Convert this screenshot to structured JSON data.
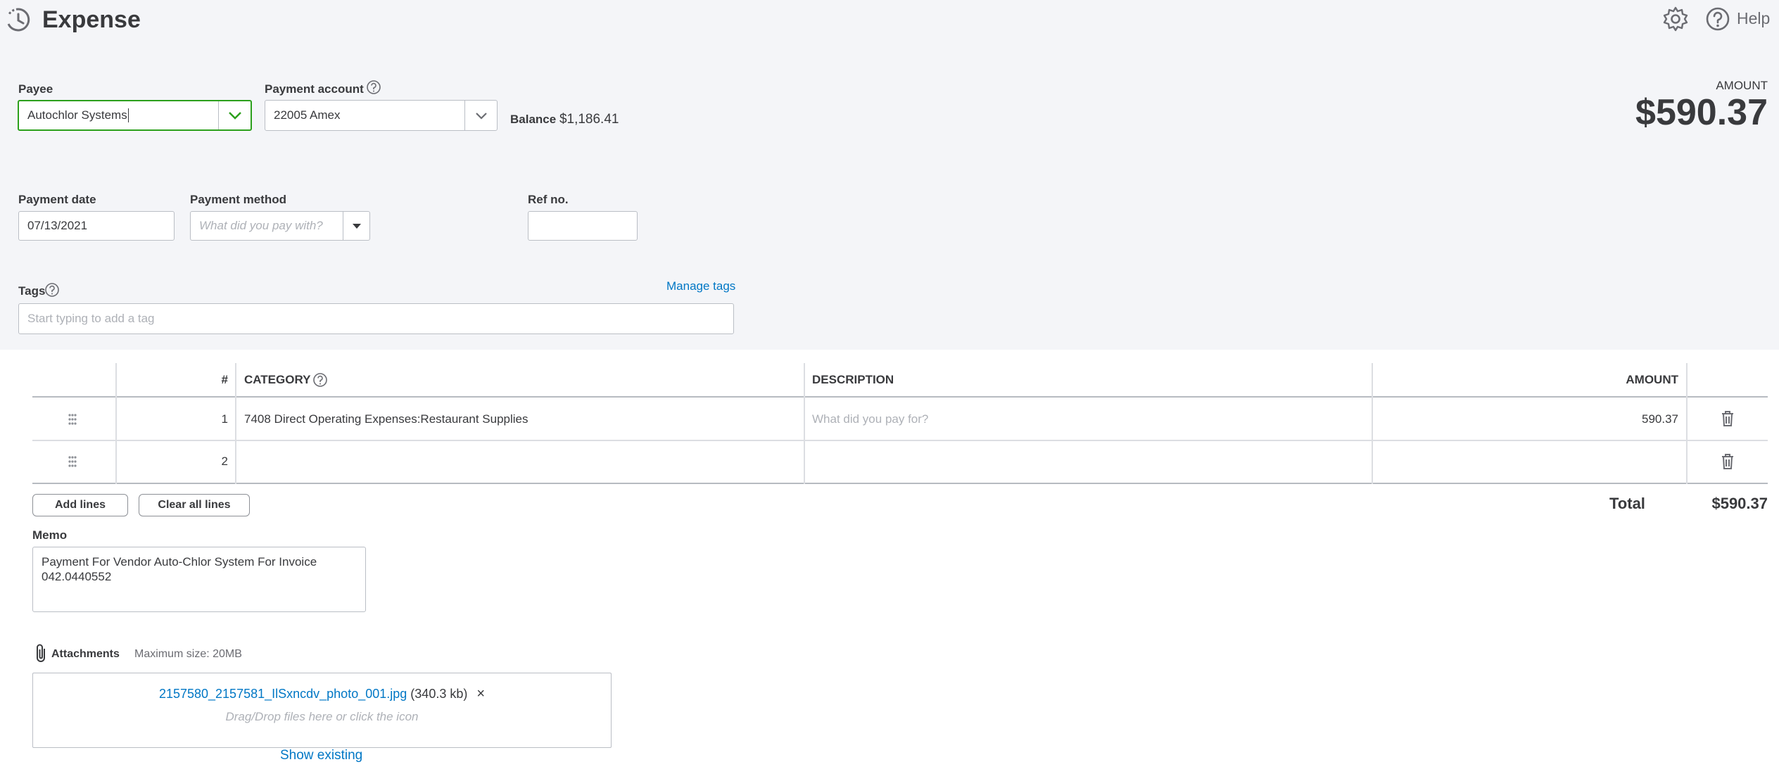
{
  "header": {
    "title": "Expense",
    "help_label": "Help"
  },
  "payee": {
    "label": "Payee",
    "value": "Autochlor Systems"
  },
  "payment_account": {
    "label": "Payment account",
    "value": "22005 Amex",
    "balance_label": "Balance",
    "balance_value": "$1,186.41"
  },
  "amount": {
    "label": "AMOUNT",
    "value": "$590.37"
  },
  "payment_date": {
    "label": "Payment date",
    "value": "07/13/2021"
  },
  "payment_method": {
    "label": "Payment method",
    "placeholder": "What did you pay with?"
  },
  "ref_no": {
    "label": "Ref no.",
    "value": ""
  },
  "tags": {
    "label": "Tags",
    "manage_link": "Manage tags",
    "placeholder": "Start typing to add a tag"
  },
  "table": {
    "headers": {
      "num": "#",
      "category": "CATEGORY",
      "description": "DESCRIPTION",
      "amount": "AMOUNT"
    },
    "rows": [
      {
        "num": "1",
        "category": "7408 Direct Operating Expenses:Restaurant Supplies",
        "description_placeholder": "What did you pay for?",
        "amount": "590.37"
      },
      {
        "num": "2",
        "category": "",
        "description_placeholder": "",
        "amount": ""
      }
    ],
    "add_lines_label": "Add lines",
    "clear_lines_label": "Clear all lines",
    "total_label": "Total",
    "total_value": "$590.37"
  },
  "memo": {
    "label": "Memo",
    "value": "Payment For Vendor Auto-Chlor System For Invoice 042.0440552"
  },
  "attachments": {
    "label": "Attachments",
    "max_size": "Maximum size: 20MB",
    "file_name": "2157580_2157581_IlSxncdv_photo_001.jpg",
    "file_size": "(340.3 kb)",
    "remove_symbol": "×",
    "drop_hint": "Drag/Drop files here or click the icon",
    "show_existing": "Show existing"
  },
  "colors": {
    "accent_green": "#2ca01c",
    "link_blue": "#0077c5",
    "header_bg": "#f4f5f8"
  }
}
